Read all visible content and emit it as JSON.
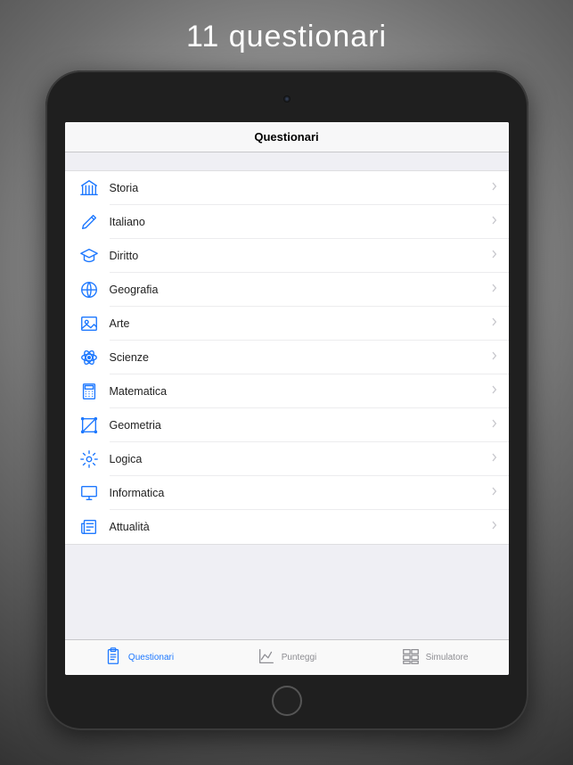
{
  "headline": "11  questionari",
  "nav_title": "Questionari",
  "categories": [
    {
      "icon": "museum-icon",
      "label": "Storia"
    },
    {
      "icon": "pen-icon",
      "label": "Italiano"
    },
    {
      "icon": "cap-icon",
      "label": "Diritto"
    },
    {
      "icon": "globe-icon",
      "label": "Geografia"
    },
    {
      "icon": "picture-icon",
      "label": "Arte"
    },
    {
      "icon": "atom-icon",
      "label": "Scienze"
    },
    {
      "icon": "calc-icon",
      "label": "Matematica"
    },
    {
      "icon": "shapes-icon",
      "label": "Geometria"
    },
    {
      "icon": "gear-icon",
      "label": "Logica"
    },
    {
      "icon": "monitor-icon",
      "label": "Informatica"
    },
    {
      "icon": "news-icon",
      "label": "Attualità"
    }
  ],
  "tabs": [
    {
      "label": "Questionari",
      "active": true,
      "icon": "clipboard-icon"
    },
    {
      "label": "Punteggi",
      "active": false,
      "icon": "chart-icon"
    },
    {
      "label": "Simulatore",
      "active": false,
      "icon": "grid-icon"
    }
  ]
}
